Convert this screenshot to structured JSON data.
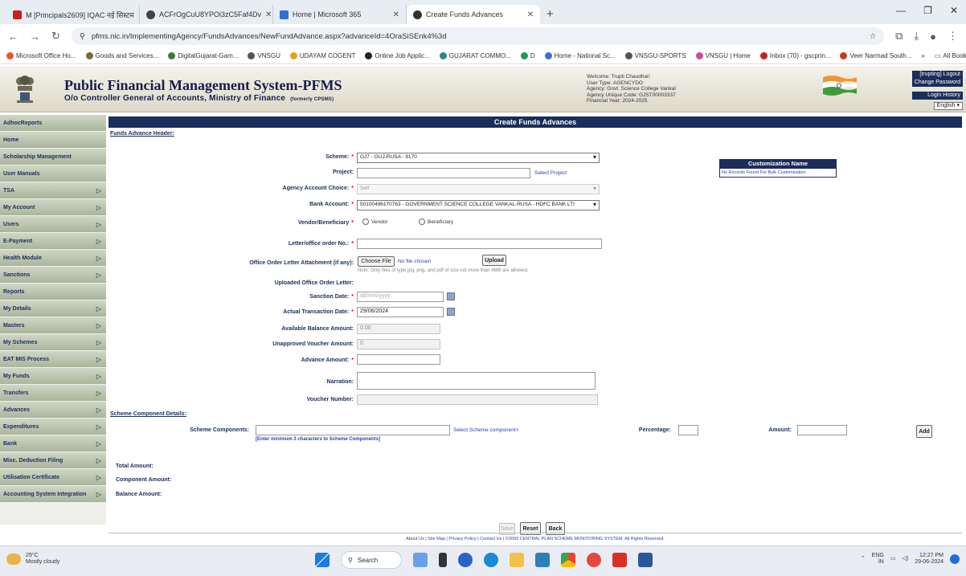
{
  "browser": {
    "tabs": [
      {
        "title": "M [Principals2609] IQAC नई सिस्टम",
        "active": false
      },
      {
        "title": "ACFrOgCuU8YPOi3zC5Faf4Dv",
        "active": false
      },
      {
        "title": "Home | Microsoft 365",
        "active": false
      },
      {
        "title": "Create Funds Advances",
        "active": true
      }
    ],
    "url": "pfms.nic.in/ImplementingAgency/FundsAdvances/NewFundAdvance.aspx?advanceId=4OraSiSEnk4%3d",
    "bookmarks": [
      "Microsoft Office Ho...",
      "Goods and Services...",
      "DigitalGujarat-Gam...",
      "VNSGU",
      "UDAYAM COGENT",
      "Online Job Applic...",
      "GUJARAT COMMO...",
      "D",
      "Home - National Sc...",
      "VNSGU-SPORTS",
      "VNSGU | Home",
      "Inbox (70) - gscprin...",
      "Veer Narmad South..."
    ],
    "all_bookmarks": "All Bookmarks"
  },
  "header": {
    "title": "Public Financial Management System-PFMS",
    "subtitle": "O/o Controller General of Accounts, Ministry of Finance",
    "formerly": "(formerly CPSMS)",
    "welcome_lines": [
      "Welcome: Trupti Chaudhari",
      "User Type: AGENCYDO",
      "Agency: Govt. Science College Vankal",
      "Agency Unique Code: GJST00003337",
      "Financial Year: 2024-2025"
    ],
    "right_links": [
      "[trupting] Logout",
      "Change Password",
      "Login History"
    ],
    "language": "English"
  },
  "sidebar": {
    "items": [
      {
        "label": "AdhocReports",
        "arrow": false
      },
      {
        "label": "Home",
        "arrow": false
      },
      {
        "label": "Scholarship Management",
        "arrow": false
      },
      {
        "label": "User Manuals",
        "arrow": false
      },
      {
        "label": "TSA",
        "arrow": true
      },
      {
        "label": "My Account",
        "arrow": true
      },
      {
        "label": "Users",
        "arrow": true
      },
      {
        "label": "E-Payment",
        "arrow": true
      },
      {
        "label": "Health Module",
        "arrow": true
      },
      {
        "label": "Sanctions",
        "arrow": true
      },
      {
        "label": "Reports",
        "arrow": false
      },
      {
        "label": "My Details",
        "arrow": true
      },
      {
        "label": "Masters",
        "arrow": true
      },
      {
        "label": "My Schemes",
        "arrow": true
      },
      {
        "label": "EAT MIS Process",
        "arrow": true
      },
      {
        "label": "My Funds",
        "arrow": true
      },
      {
        "label": "Transfers",
        "arrow": true
      },
      {
        "label": "Advances",
        "arrow": true
      },
      {
        "label": "Expenditures",
        "arrow": true
      },
      {
        "label": "Bank",
        "arrow": true
      },
      {
        "label": "Misc. Deduction Filing",
        "arrow": true
      },
      {
        "label": "Utilisation Certificate",
        "arrow": true
      },
      {
        "label": "Accounting System Integration",
        "arrow": true
      }
    ]
  },
  "form": {
    "page_title": "Create Funds Advances",
    "header_section": "Funds Advance Header:",
    "scheme_label": "Scheme:",
    "scheme_value": "GJ7 - GUJ-RUSA - 9170",
    "project_label": "Project:",
    "project_value": "",
    "select_project": "Select Project",
    "agency_account_label": "Agency Account Choice:",
    "agency_account_value": "Self",
    "bank_account_label": "Bank Account:",
    "bank_account_value": "50100496170763 - GOVERNMENT SCIENCE COLLEGE VANKAL-RUSA - HDFC BANK LTI",
    "vendor_label": "Vendor/Beneficiary",
    "vendor_option": "Vendor",
    "beneficiary_option": "Beneficiary",
    "letter_label": "Letter/office order No.:",
    "attachment_label": "Office Order Letter Attachment (if any):",
    "choose_file": "Choose File",
    "no_file": "No file chosen",
    "upload": "Upload",
    "file_note": "Note: Only files of type jpg, png, and pdf of size not more than 4MB are allowed.",
    "uploaded_label": "Uploaded Office Order Letter:",
    "sanction_date_label": "Sanction Date:",
    "sanction_date_placeholder": "dd/mm/yyyy",
    "actual_date_label": "Actual Transaction Date:",
    "actual_date_value": "29/06/2024",
    "available_label": "Available Balance Amount:",
    "available_value": "0.00",
    "unapproved_label": "Unapproved Voucher Amount:",
    "unapproved_value": "0",
    "advance_label": "Advance Amount:",
    "narration_label": "Narration:",
    "voucher_label": "Voucher Number:",
    "component_section": "Scheme Component Details:",
    "components_label": "Scheme Components:",
    "components_hint": "[Enter minimum 3 characters to Scheme Components]",
    "select_component": "Select Scheme component>",
    "percentage_label": "Percentage:",
    "amount_label": "Amount:",
    "add": "Add",
    "total_label": "Total Amount:",
    "component_amount_label": "Component Amount:",
    "balance_label": "Balance Amount:",
    "save": "Save",
    "reset": "Reset",
    "back": "Back"
  },
  "customization": {
    "title": "Customization Name",
    "body": "No Records Found For Bulk Customization"
  },
  "footer": "About Us | Site Map | Privacy Policy | Contact Us | ©2009 CENTRAL PLAN SCHEME MONITORING SYSTEM. All Rights Reserved.",
  "taskbar": {
    "temp": "29°C",
    "weather": "Mostly cloudy",
    "search": "Search",
    "lang": "ENG",
    "region": "IN",
    "time": "12:27 PM",
    "date": "29-06-2024"
  }
}
